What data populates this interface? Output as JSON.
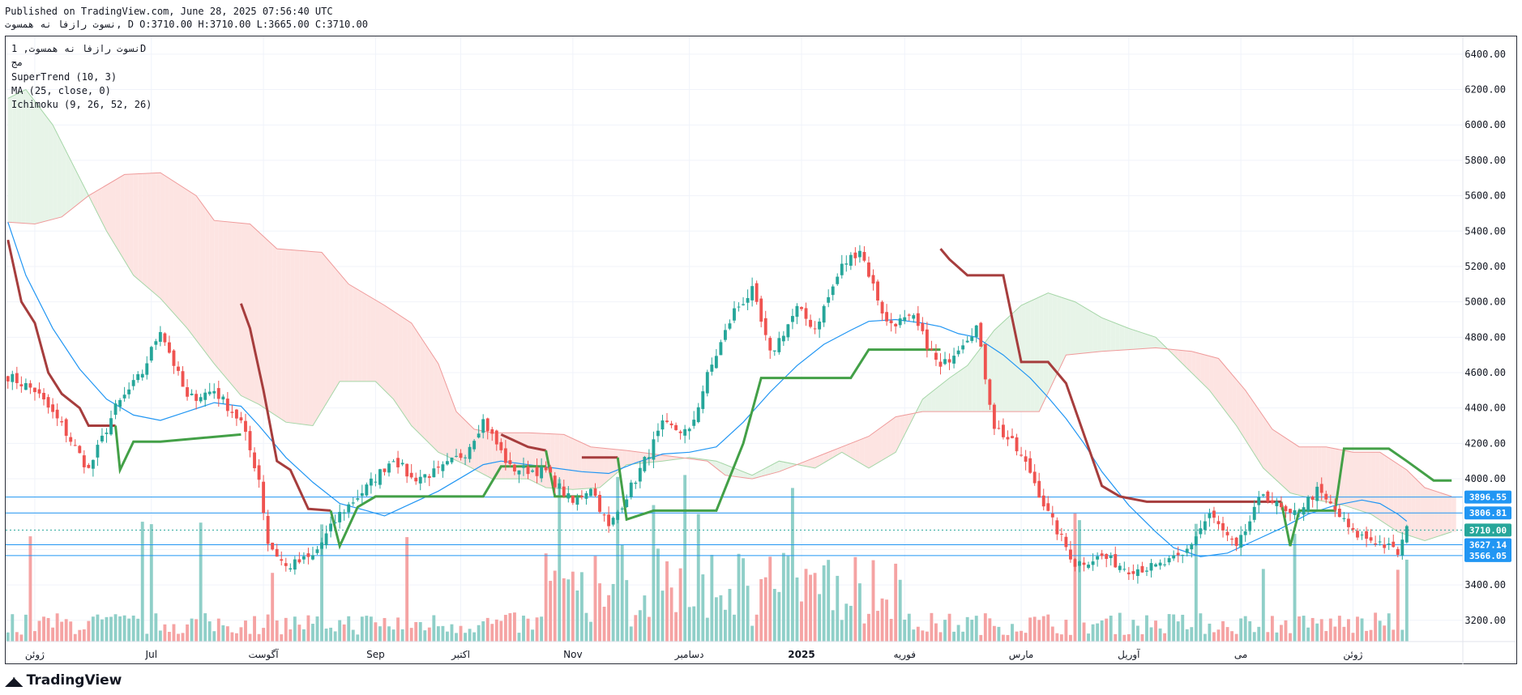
{
  "header": {
    "published": "Published on TradingView.com, June 28, 2025 07:56:40 UTC",
    "symbol_line": "نسوت رازفا نه همسوت, D O:3710.00 H:3710.00 L:3665.00 C:3710.00"
  },
  "legend": {
    "title": "نسوت رازفا نه همسوت, 1D",
    "exchange": "مج",
    "supertrend": "SuperTrend (10, 3)",
    "ma": "MA (25, close, 0)",
    "ichimoku": "Ichimoku (9, 26, 52, 26)"
  },
  "brand": {
    "logo_icon": "tradingview-logo-icon",
    "name": "TradingView"
  },
  "colors": {
    "up": "#26a69a",
    "down": "#ef5350",
    "volume_up": "#8fcfc8",
    "volume_down": "#f5a3a3",
    "supertrend_up": "#43a047",
    "supertrend_down": "#a63d3d",
    "ma": "#2196f3",
    "cloud_bull": "#e7f4e8",
    "cloud_bear": "#fde4e2",
    "level_line": "#2196f3",
    "last_price_bg": "#26a69a"
  },
  "chart_data": {
    "type": "candlestick",
    "y_ticks": [
      3200,
      3400,
      3600,
      3800,
      4000,
      4200,
      4400,
      4600,
      4800,
      5000,
      5200,
      5400,
      5600,
      5800,
      6000,
      6200,
      6400
    ],
    "y_tick_labels": [
      "3200.00",
      "3400.00",
      "3600.00",
      "3800.00",
      "4000.00",
      "4200.00",
      "4400.00",
      "4600.00",
      "4800.00",
      "5000.00",
      "5200.00",
      "5400.00",
      "5600.00",
      "5800.00",
      "6000.00",
      "6200.00",
      "6400.00"
    ],
    "ylim": [
      3080,
      6500
    ],
    "x_labels": [
      "ژوئن",
      "Jul",
      "آگوست",
      "Sep",
      "اکتبر",
      "Nov",
      "دسامبر",
      "2025",
      "فوریه",
      "مارس",
      "آوریل",
      "می",
      "ژوئن"
    ],
    "x_label_bar_index": [
      6,
      32,
      57,
      82,
      101,
      126,
      152,
      177,
      200,
      226,
      250,
      275,
      300
    ],
    "bar_count": 325,
    "anchors": [
      [
        0,
        4580
      ],
      [
        6,
        4500
      ],
      [
        12,
        4300
      ],
      [
        18,
        4050
      ],
      [
        24,
        4400
      ],
      [
        30,
        4600
      ],
      [
        34,
        4850
      ],
      [
        40,
        4450
      ],
      [
        46,
        4500
      ],
      [
        52,
        4320
      ],
      [
        56,
        4000
      ],
      [
        58,
        3640
      ],
      [
        62,
        3500
      ],
      [
        68,
        3560
      ],
      [
        74,
        3800
      ],
      [
        80,
        3950
      ],
      [
        86,
        4120
      ],
      [
        90,
        4000
      ],
      [
        96,
        4040
      ],
      [
        102,
        4150
      ],
      [
        106,
        4330
      ],
      [
        112,
        4060
      ],
      [
        120,
        4040
      ],
      [
        126,
        3860
      ],
      [
        130,
        3960
      ],
      [
        134,
        3720
      ],
      [
        140,
        4000
      ],
      [
        146,
        4300
      ],
      [
        152,
        4260
      ],
      [
        156,
        4580
      ],
      [
        162,
        4950
      ],
      [
        166,
        5060
      ],
      [
        170,
        4700
      ],
      [
        176,
        4960
      ],
      [
        180,
        4850
      ],
      [
        186,
        5200
      ],
      [
        190,
        5300
      ],
      [
        196,
        4880
      ],
      [
        202,
        4900
      ],
      [
        208,
        4620
      ],
      [
        212,
        4750
      ],
      [
        216,
        4860
      ],
      [
        220,
        4300
      ],
      [
        224,
        4200
      ],
      [
        228,
        4040
      ],
      [
        232,
        3800
      ],
      [
        238,
        3520
      ],
      [
        244,
        3560
      ],
      [
        250,
        3490
      ],
      [
        256,
        3500
      ],
      [
        262,
        3560
      ],
      [
        268,
        3800
      ],
      [
        274,
        3600
      ],
      [
        280,
        3920
      ],
      [
        286,
        3780
      ],
      [
        292,
        3930
      ],
      [
        296,
        3820
      ],
      [
        300,
        3690
      ],
      [
        306,
        3640
      ],
      [
        310,
        3580
      ],
      [
        312,
        3710
      ]
    ],
    "supertrend_segments": [
      {
        "trend": "down",
        "points": [
          [
            0,
            5350
          ],
          [
            3,
            5000
          ],
          [
            6,
            4880
          ],
          [
            9,
            4600
          ],
          [
            12,
            4480
          ],
          [
            16,
            4400
          ],
          [
            18,
            4300
          ],
          [
            24,
            4300
          ]
        ]
      },
      {
        "trend": "up",
        "points": [
          [
            24,
            4300
          ],
          [
            25,
            4050
          ],
          [
            28,
            4210
          ],
          [
            34,
            4210
          ],
          [
            52,
            4250
          ]
        ]
      },
      {
        "trend": "down",
        "points": [
          [
            52,
            4990
          ],
          [
            54,
            4850
          ],
          [
            57,
            4500
          ],
          [
            60,
            4100
          ],
          [
            63,
            4050
          ],
          [
            67,
            3830
          ],
          [
            72,
            3820
          ]
        ]
      },
      {
        "trend": "up",
        "points": [
          [
            72,
            3820
          ],
          [
            74,
            3620
          ],
          [
            78,
            3840
          ],
          [
            82,
            3900
          ],
          [
            106,
            3900
          ],
          [
            110,
            4070
          ],
          [
            120,
            4070
          ]
        ]
      },
      {
        "trend": "down",
        "points": [
          [
            110,
            4250
          ],
          [
            116,
            4180
          ],
          [
            120,
            4160
          ]
        ]
      },
      {
        "trend": "up",
        "points": [
          [
            120,
            4160
          ],
          [
            122,
            3900
          ],
          [
            128,
            3900
          ]
        ]
      },
      {
        "trend": "down",
        "points": [
          [
            128,
            4120
          ],
          [
            136,
            4120
          ]
        ]
      },
      {
        "trend": "up",
        "points": [
          [
            136,
            4120
          ],
          [
            138,
            3770
          ],
          [
            144,
            3820
          ],
          [
            158,
            3820
          ],
          [
            164,
            4200
          ],
          [
            168,
            4570
          ],
          [
            188,
            4570
          ],
          [
            192,
            4730
          ],
          [
            208,
            4730
          ]
        ]
      },
      {
        "trend": "down",
        "points": [
          [
            208,
            5300
          ],
          [
            210,
            5240
          ],
          [
            214,
            5150
          ],
          [
            222,
            5150
          ],
          [
            226,
            4660
          ],
          [
            232,
            4660
          ],
          [
            236,
            4540
          ],
          [
            240,
            4250
          ],
          [
            244,
            3960
          ],
          [
            248,
            3900
          ],
          [
            254,
            3870
          ],
          [
            260,
            3870
          ],
          [
            284,
            3870
          ]
        ]
      },
      {
        "trend": "up",
        "points": [
          [
            284,
            3870
          ],
          [
            286,
            3620
          ],
          [
            288,
            3820
          ],
          [
            296,
            3820
          ],
          [
            298,
            4170
          ],
          [
            308,
            4170
          ],
          [
            312,
            4100
          ],
          [
            318,
            3990
          ],
          [
            322,
            3990
          ]
        ]
      }
    ],
    "ma_points": [
      [
        0,
        5450
      ],
      [
        4,
        5150
      ],
      [
        10,
        4850
      ],
      [
        16,
        4620
      ],
      [
        22,
        4450
      ],
      [
        28,
        4360
      ],
      [
        34,
        4330
      ],
      [
        40,
        4380
      ],
      [
        46,
        4430
      ],
      [
        52,
        4410
      ],
      [
        56,
        4300
      ],
      [
        62,
        4120
      ],
      [
        68,
        3980
      ],
      [
        74,
        3860
      ],
      [
        80,
        3820
      ],
      [
        84,
        3790
      ],
      [
        90,
        3860
      ],
      [
        96,
        3930
      ],
      [
        102,
        4020
      ],
      [
        106,
        4080
      ],
      [
        110,
        4100
      ],
      [
        116,
        4080
      ],
      [
        122,
        4060
      ],
      [
        128,
        4040
      ],
      [
        134,
        4030
      ],
      [
        140,
        4090
      ],
      [
        146,
        4140
      ],
      [
        152,
        4150
      ],
      [
        158,
        4180
      ],
      [
        164,
        4320
      ],
      [
        170,
        4490
      ],
      [
        176,
        4640
      ],
      [
        182,
        4760
      ],
      [
        188,
        4840
      ],
      [
        192,
        4890
      ],
      [
        198,
        4900
      ],
      [
        204,
        4880
      ],
      [
        208,
        4860
      ],
      [
        212,
        4820
      ],
      [
        216,
        4800
      ],
      [
        222,
        4700
      ],
      [
        228,
        4570
      ],
      [
        232,
        4460
      ],
      [
        236,
        4340
      ],
      [
        240,
        4200
      ],
      [
        244,
        4040
      ],
      [
        250,
        3850
      ],
      [
        256,
        3700
      ],
      [
        260,
        3610
      ],
      [
        266,
        3560
      ],
      [
        272,
        3580
      ],
      [
        278,
        3650
      ],
      [
        284,
        3720
      ],
      [
        290,
        3800
      ],
      [
        296,
        3850
      ],
      [
        302,
        3880
      ],
      [
        306,
        3860
      ],
      [
        310,
        3800
      ],
      [
        312,
        3760
      ]
    ],
    "cloud": {
      "span_a": [
        [
          0,
          6150
        ],
        [
          4,
          6200
        ],
        [
          10,
          6000
        ],
        [
          16,
          5700
        ],
        [
          22,
          5400
        ],
        [
          28,
          5150
        ],
        [
          34,
          5020
        ],
        [
          40,
          4850
        ],
        [
          46,
          4650
        ],
        [
          52,
          4470
        ],
        [
          56,
          4420
        ],
        [
          62,
          4320
        ],
        [
          68,
          4300
        ],
        [
          74,
          4550
        ],
        [
          82,
          4550
        ],
        [
          86,
          4450
        ],
        [
          90,
          4300
        ],
        [
          96,
          4150
        ],
        [
          102,
          4080
        ],
        [
          108,
          4000
        ],
        [
          116,
          4000
        ],
        [
          120,
          3950
        ],
        [
          126,
          3940
        ],
        [
          132,
          3950
        ],
        [
          138,
          4080
        ],
        [
          146,
          4100
        ],
        [
          152,
          4120
        ],
        [
          158,
          4100
        ],
        [
          166,
          4020
        ],
        [
          172,
          4100
        ],
        [
          180,
          4060
        ],
        [
          186,
          4150
        ],
        [
          192,
          4060
        ],
        [
          198,
          4150
        ],
        [
          204,
          4450
        ],
        [
          210,
          4570
        ],
        [
          214,
          4640
        ],
        [
          220,
          4840
        ],
        [
          226,
          4980
        ],
        [
          232,
          5050
        ],
        [
          238,
          5000
        ],
        [
          244,
          4910
        ],
        [
          250,
          4850
        ],
        [
          256,
          4800
        ],
        [
          262,
          4650
        ],
        [
          268,
          4500
        ],
        [
          274,
          4300
        ],
        [
          280,
          4060
        ],
        [
          286,
          3920
        ],
        [
          292,
          3880
        ],
        [
          298,
          3850
        ],
        [
          304,
          3800
        ],
        [
          310,
          3700
        ],
        [
          316,
          3650
        ],
        [
          322,
          3700
        ]
      ],
      "span_b": [
        [
          0,
          5450
        ],
        [
          6,
          5440
        ],
        [
          12,
          5480
        ],
        [
          18,
          5600
        ],
        [
          26,
          5720
        ],
        [
          34,
          5730
        ],
        [
          42,
          5600
        ],
        [
          46,
          5460
        ],
        [
          54,
          5440
        ],
        [
          60,
          5300
        ],
        [
          70,
          5280
        ],
        [
          76,
          5100
        ],
        [
          84,
          4980
        ],
        [
          90,
          4880
        ],
        [
          96,
          4650
        ],
        [
          100,
          4380
        ],
        [
          104,
          4280
        ],
        [
          108,
          4260
        ],
        [
          116,
          4260
        ],
        [
          124,
          4250
        ],
        [
          130,
          4180
        ],
        [
          138,
          4160
        ],
        [
          144,
          4140
        ],
        [
          150,
          4120
        ],
        [
          156,
          4100
        ],
        [
          160,
          4020
        ],
        [
          166,
          4000
        ],
        [
          172,
          4040
        ],
        [
          180,
          4120
        ],
        [
          186,
          4180
        ],
        [
          192,
          4240
        ],
        [
          198,
          4350
        ],
        [
          204,
          4380
        ],
        [
          210,
          4380
        ],
        [
          216,
          4380
        ],
        [
          222,
          4380
        ],
        [
          230,
          4380
        ],
        [
          236,
          4700
        ],
        [
          244,
          4720
        ],
        [
          250,
          4730
        ],
        [
          256,
          4740
        ],
        [
          264,
          4720
        ],
        [
          270,
          4680
        ],
        [
          276,
          4500
        ],
        [
          282,
          4280
        ],
        [
          288,
          4180
        ],
        [
          294,
          4180
        ],
        [
          300,
          4150
        ],
        [
          306,
          4150
        ],
        [
          312,
          4050
        ],
        [
          316,
          3950
        ],
        [
          322,
          3900
        ]
      ]
    },
    "price_levels": [
      {
        "value": 3896.55,
        "label": "3896.55"
      },
      {
        "value": 3806.81,
        "label": "3806.81"
      },
      {
        "value": 3627.14,
        "label": "3627.14"
      },
      {
        "value": 3566.05,
        "label": "3566.05"
      }
    ],
    "last_price": {
      "value": 3710.0,
      "label": "3710.00"
    }
  }
}
